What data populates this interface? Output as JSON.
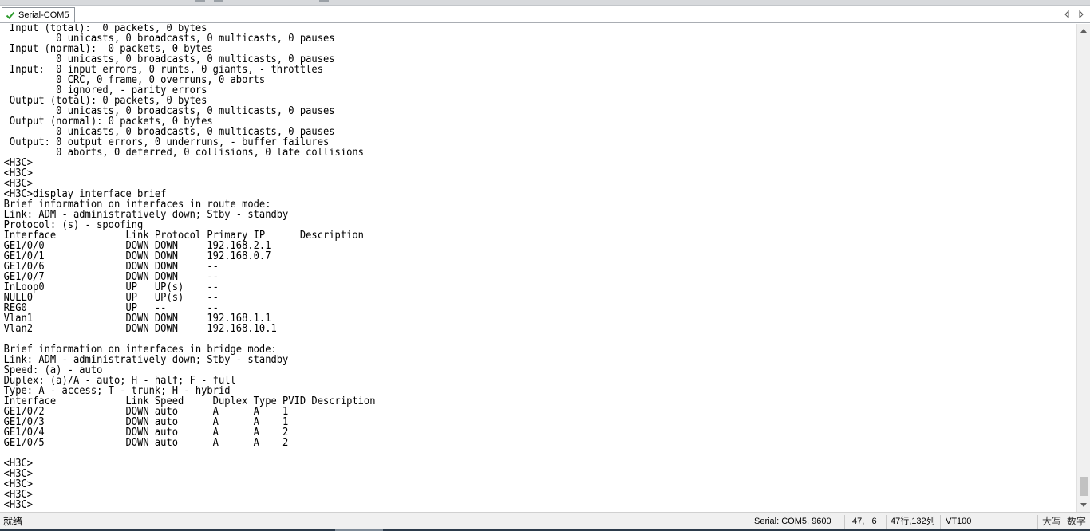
{
  "tab": {
    "title": "Serial-COM5"
  },
  "terminal": {
    "lines": [
      " Input (total):  0 packets, 0 bytes",
      "         0 unicasts, 0 broadcasts, 0 multicasts, 0 pauses",
      " Input (normal):  0 packets, 0 bytes",
      "         0 unicasts, 0 broadcasts, 0 multicasts, 0 pauses",
      " Input:  0 input errors, 0 runts, 0 giants, - throttles",
      "         0 CRC, 0 frame, 0 overruns, 0 aborts",
      "         0 ignored, - parity errors",
      " Output (total): 0 packets, 0 bytes",
      "         0 unicasts, 0 broadcasts, 0 multicasts, 0 pauses",
      " Output (normal): 0 packets, 0 bytes",
      "         0 unicasts, 0 broadcasts, 0 multicasts, 0 pauses",
      " Output: 0 output errors, 0 underruns, - buffer failures",
      "         0 aborts, 0 deferred, 0 collisions, 0 late collisions",
      "<H3C>",
      "<H3C>",
      "<H3C>",
      "<H3C>display interface brief",
      "Brief information on interfaces in route mode:",
      "Link: ADM - administratively down; Stby - standby",
      "Protocol: (s) - spoofing",
      "Interface            Link Protocol Primary IP      Description",
      "GE1/0/0              DOWN DOWN     192.168.2.1",
      "GE1/0/1              DOWN DOWN     192.168.0.7",
      "GE1/0/6              DOWN DOWN     --",
      "GE1/0/7              DOWN DOWN     --",
      "InLoop0              UP   UP(s)    --",
      "NULL0                UP   UP(s)    --",
      "REG0                 UP   --       --",
      "Vlan1                DOWN DOWN     192.168.1.1",
      "Vlan2                DOWN DOWN     192.168.10.1",
      "",
      "Brief information on interfaces in bridge mode:",
      "Link: ADM - administratively down; Stby - standby",
      "Speed: (a) - auto",
      "Duplex: (a)/A - auto; H - half; F - full",
      "Type: A - access; T - trunk; H - hybrid",
      "Interface            Link Speed     Duplex Type PVID Description",
      "GE1/0/2              DOWN auto      A      A    1",
      "GE1/0/3              DOWN auto      A      A    1",
      "GE1/0/4              DOWN auto      A      A    2",
      "GE1/0/5              DOWN auto      A      A    2",
      "",
      "<H3C>",
      "<H3C>",
      "<H3C>",
      "<H3C>",
      "<H3C>"
    ]
  },
  "statusbar": {
    "ready": "就绪",
    "connection": "Serial: COM5, 9600",
    "cursor": "47,   6",
    "rows_cols": "47行,132列",
    "emulation": "VT100",
    "caps": "大写",
    "num": "数字"
  },
  "icons": {
    "tab_status": "check-icon",
    "tab_prev": "triangle-left-icon",
    "tab_next": "triangle-right-icon",
    "scroll_up": "arrow-up-icon",
    "scroll_down": "arrow-down-icon"
  },
  "colors": {
    "check_green": "#2e9b2e",
    "terminal_bg": "#ffffff",
    "terminal_fg": "#000000"
  }
}
